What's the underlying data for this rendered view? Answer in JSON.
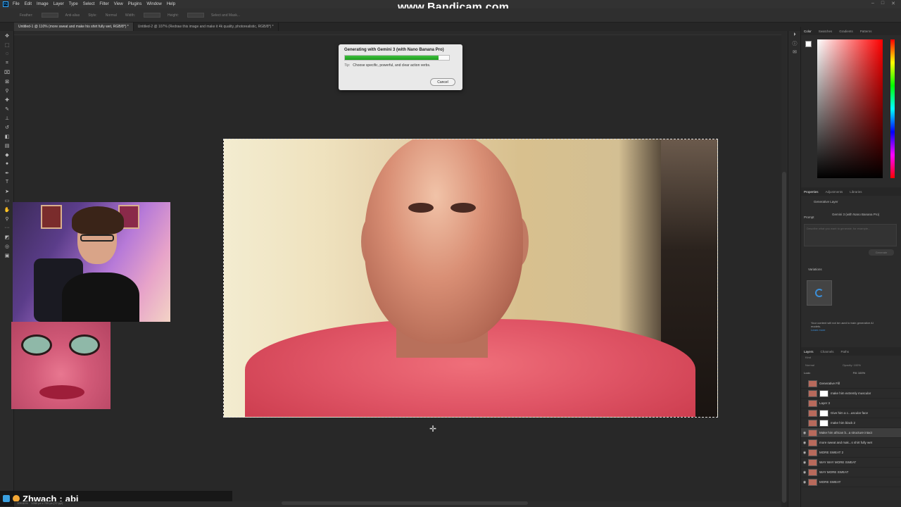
{
  "watermark": "www.Bandicam.com",
  "menu": [
    "File",
    "Edit",
    "Image",
    "Layer",
    "Type",
    "Select",
    "Filter",
    "View",
    "Plugins",
    "Window",
    "Help"
  ],
  "options_bar": {
    "feather": "Feather:",
    "anti_alias": "Anti-alias",
    "style": "Style:",
    "style_value": "Normal",
    "width": "Width:",
    "height": "Height:",
    "select_mask": "Select and Mask..."
  },
  "tabs": [
    {
      "label": "Untitled-1 @ 110% (more sweat and make his shirt fully wet, RGB/8*) *"
    },
    {
      "label": "Untitled-2 @ 107% (Redraw this image and make it 4k quality, photorealistic, RGB/8*) *"
    }
  ],
  "dialog": {
    "title": "Generating with Gemini 3 (with Nano Banana Pro)",
    "progress": 0.9,
    "tip_label": "Tip:",
    "tip_text": "Choose specific, powerful, and clear action verbs.",
    "cancel": "Cancel"
  },
  "chat": {
    "user": "Zhwach",
    "separator": " : ",
    "message": "abi"
  },
  "status": {
    "zoom": "109.81%",
    "size": "1280 px x 720 px (72 ppi)"
  },
  "panels": {
    "color_tabs": [
      "Color",
      "Swatches",
      "Gradients",
      "Patterns"
    ],
    "props_tabs": [
      "Properties",
      "Adjustments",
      "Libraries"
    ],
    "layer_type": "Generative Layer",
    "model": "Gemini 3 (with Nano Banana Pro)",
    "prompt_label": "Prompt",
    "prompt_placeholder": "Describe what you want to generate, for example...",
    "generate_btn": "Generate",
    "variations_label": "Variations",
    "notice": "Your content will not be used to train generative AI models.",
    "learn_more": "Learn more",
    "layers_tabs": [
      "Layers",
      "Channels",
      "Paths"
    ],
    "layers_kind": "Kind",
    "blend": "Normal",
    "opacity": "Opacity: 100%",
    "lock": "Lock:",
    "fill": "Fill: 100%"
  },
  "layers": [
    {
      "name": "Generative Fill",
      "visible": false,
      "mask": false
    },
    {
      "name": "make him extremly muscular",
      "visible": false,
      "mask": true
    },
    {
      "name": "Layer 3",
      "visible": false,
      "mask": false
    },
    {
      "name": "Give him a c...uscular face",
      "visible": false,
      "mask": true
    },
    {
      "name": "make him black 2",
      "visible": false,
      "mask": true
    },
    {
      "name": "Make him african b...a structure intact",
      "visible": true,
      "mask": false,
      "selected": true
    },
    {
      "name": "more sweat and mak...s shirt fully wet",
      "visible": true,
      "mask": false
    },
    {
      "name": "MORE SWEAT 2",
      "visible": true,
      "mask": false
    },
    {
      "name": "WAY WAY MORE SWEAT",
      "visible": true,
      "mask": false
    },
    {
      "name": "WAY MORE SWEAT",
      "visible": true,
      "mask": false
    },
    {
      "name": "MORE SWEAT",
      "visible": true,
      "mask": false
    }
  ]
}
